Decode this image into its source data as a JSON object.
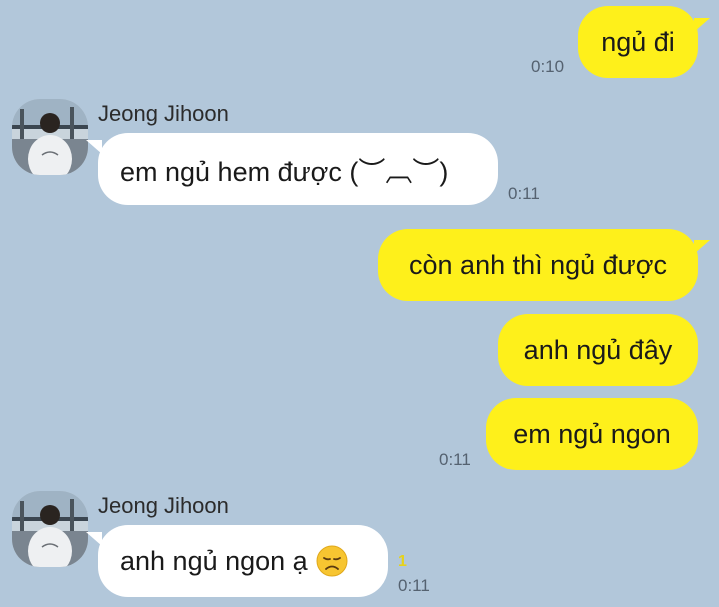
{
  "contact": {
    "name": "Jeong Jihoon"
  },
  "colors": {
    "background": "#b2c7da",
    "outgoing_bubble": "#fef01b",
    "incoming_bubble": "#ffffff",
    "unread_badge": "#e6d21a"
  },
  "messages": [
    {
      "direction": "out",
      "text": "ngủ đi",
      "time": "0:10"
    },
    {
      "direction": "in",
      "sender": "Jeong Jihoon",
      "text": "em ngủ hem được (︶︹︶)",
      "time": "0:11"
    },
    {
      "direction": "out",
      "text": "còn anh thì ngủ được"
    },
    {
      "direction": "out",
      "text": "anh ngủ đây"
    },
    {
      "direction": "out",
      "text": "em ngủ ngon",
      "time": "0:11"
    },
    {
      "direction": "in",
      "sender": "Jeong Jihoon",
      "text": "anh ngủ ngon ạ",
      "emoji": "disappointed-face-icon",
      "unread": "1",
      "time": "0:11"
    }
  ]
}
